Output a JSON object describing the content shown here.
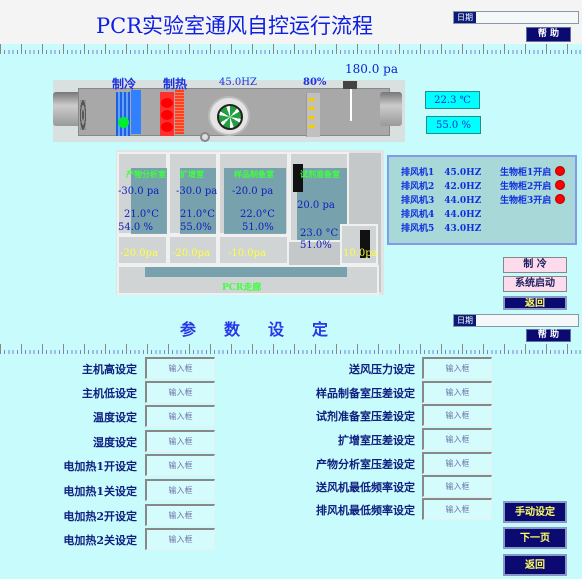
{
  "header": {
    "title": "PCR实验室通风自控运行流程",
    "date_label": "日期",
    "date_value": "",
    "help_label": "帮 助"
  },
  "ahu": {
    "cooling_label": "制冷",
    "heating_label": "制热",
    "fan_frequency": "45.0HZ",
    "damper_percent": "80%",
    "supply_pressure": "180.0 pa",
    "temperature": "22.3 ℃",
    "humidity": "55.0 %",
    "cooling_indicator_color": "#00ee30",
    "heating_indicator_color": "#ff0000"
  },
  "rooms": [
    {
      "name": "产物分析室",
      "pressure": "-30.0 pa",
      "temperature": "21.0°C",
      "humidity": "54.0 %",
      "buffer_pressure": "-20.0pa"
    },
    {
      "name": "扩增室",
      "pressure": "-30.0 pa",
      "temperature": "21.0°C",
      "humidity": "55.0%",
      "buffer_pressure": "-20.0pa"
    },
    {
      "name": "样品制备室",
      "pressure": "-20.0 pa",
      "temperature": "22.0°C",
      "humidity": "51.0%",
      "buffer_pressure": "-10.0pa"
    },
    {
      "name": "试剂准备室",
      "pressure": "20.0 pa",
      "temperature": "23.0 °C",
      "humidity": "51.0%",
      "buffer_pressure": "10.0pa"
    }
  ],
  "corridor_label": "PCR走廊",
  "exhaust_fans": [
    {
      "name": "排风机1",
      "freq": "45.0HZ"
    },
    {
      "name": "排风机2",
      "freq": "42.0HZ"
    },
    {
      "name": "排风机3",
      "freq": "44.0HZ"
    },
    {
      "name": "排风机4",
      "freq": "44.0HZ"
    },
    {
      "name": "排风机5",
      "freq": "43.0HZ"
    }
  ],
  "biosafety_cabinets": [
    {
      "label": "生物柜1开启",
      "status_color": "#ff0000"
    },
    {
      "label": "生物柜2开启",
      "status_color": "#ff0000"
    },
    {
      "label": "生物柜3开启",
      "status_color": "#ff0000"
    }
  ],
  "controls": {
    "mode_label": "制 冷",
    "start_label": "系统启动",
    "back_label": "返回"
  },
  "settings": {
    "title": "参数设定",
    "date_label": "日期",
    "help_label": "帮 助",
    "placeholder": "输入框",
    "left": [
      "主机高设定",
      "主机低设定",
      "温度设定",
      "湿度设定",
      "电加热1开设定",
      "电加热1关设定",
      "电加热2开设定",
      "电加热2关设定"
    ],
    "right": [
      "送风压力设定",
      "样品制备室压差设定",
      "试剂准备室压差设定",
      "扩增室压差设定",
      "产物分析室压差设定",
      "送风机最低频率设定",
      "排风机最低频率设定"
    ],
    "manual_label": "手动设定",
    "next_label": "下一页",
    "back_label": "返回"
  }
}
